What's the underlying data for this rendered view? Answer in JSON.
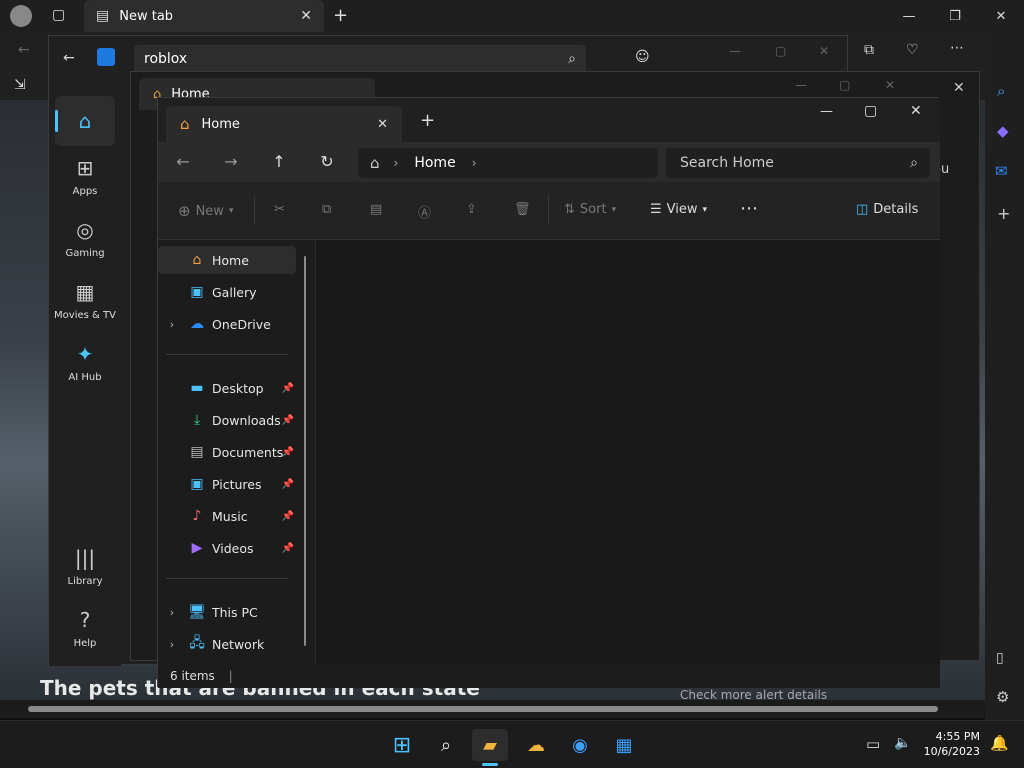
{
  "edge": {
    "tab_title": "New tab",
    "headline": "The pets that are banned in each state",
    "alert_link": "Check more alert details",
    "side_partial_text": "ou"
  },
  "store": {
    "search_value": "roblox",
    "nav": [
      {
        "label": "Home"
      },
      {
        "label": "Apps"
      },
      {
        "label": "Gaming"
      },
      {
        "label": "Movies & TV"
      },
      {
        "label": "AI Hub"
      },
      {
        "label": "Library"
      },
      {
        "label": "Help"
      }
    ]
  },
  "explorer_back": {
    "tab_title": "Home"
  },
  "explorer": {
    "tab_title": "Home",
    "breadcrumb": "Home",
    "search_placeholder": "Search Home",
    "commands": {
      "new": "New",
      "sort": "Sort",
      "view": "View",
      "details": "Details"
    },
    "nav_items": [
      {
        "label": "Home",
        "icon": "home-icon"
      },
      {
        "label": "Gallery",
        "icon": "gallery-icon"
      },
      {
        "label": "OneDrive",
        "icon": "onedrive-icon"
      },
      {
        "label": "Desktop",
        "icon": "desktop-icon"
      },
      {
        "label": "Downloads",
        "icon": "downloads-icon"
      },
      {
        "label": "Documents",
        "icon": "documents-icon"
      },
      {
        "label": "Pictures",
        "icon": "pictures-icon"
      },
      {
        "label": "Music",
        "icon": "music-icon"
      },
      {
        "label": "Videos",
        "icon": "videos-icon"
      },
      {
        "label": "This PC",
        "icon": "this-pc-icon"
      },
      {
        "label": "Network",
        "icon": "network-icon"
      }
    ],
    "status": "6 items"
  },
  "taskbar": {
    "time": "4:55 PM",
    "date": "10/6/2023"
  },
  "colors": {
    "accent": "#4cc2ff",
    "taskbar": "#1c1c1c"
  }
}
